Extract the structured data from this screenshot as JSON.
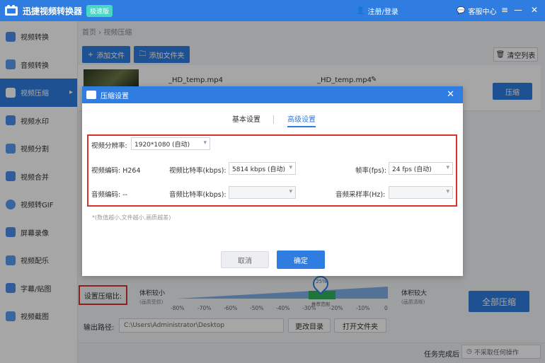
{
  "titlebar": {
    "app_title": "迅捷视频转换器",
    "badge": "极速版",
    "login": "注册/登录",
    "service": "客服中心",
    "minimize": "—",
    "close": "✕"
  },
  "sidebar": {
    "items": [
      {
        "label": "视频转换"
      },
      {
        "label": "音频转换"
      },
      {
        "label": "视频压缩"
      },
      {
        "label": "视频水印"
      },
      {
        "label": "视频分割"
      },
      {
        "label": "视频合并"
      },
      {
        "label": "视频转GIF"
      },
      {
        "label": "屏幕录像"
      },
      {
        "label": "视频配乐"
      },
      {
        "label": "字幕/贴图"
      },
      {
        "label": "视频截图"
      }
    ]
  },
  "breadcrumb": "首页 › 视频压缩",
  "toolbar": {
    "add_file": "添加文件",
    "add_folder": "添加文件夹",
    "clear_list": "清空列表"
  },
  "file": {
    "name_left": "_HD_temp.mp4",
    "name_right": "_HD_temp.mp4",
    "compress_btn": "压缩"
  },
  "dialog": {
    "title": "压缩设置",
    "tab_basic": "基本设置",
    "tab_advanced": "高级设置",
    "resolution_label": "视频分辨率:",
    "resolution_value": "1920*1080 (自动)",
    "video_codec": "视频编码: H264",
    "video_bitrate_label": "视频比特率(kbps):",
    "video_bitrate_value": "5814 kbps (自动)",
    "fps_label": "帧率(fps):",
    "fps_value": "24 fps (自动)",
    "audio_codec": "音频编码: --",
    "audio_bitrate_label": "音频比特率(kbps):",
    "audio_sample_label": "音频采样率(Hz):",
    "hint": "*(数值越小,文件越小,画质越差)",
    "cancel": "取消",
    "confirm": "确定"
  },
  "compression": {
    "ratio_label": "设置压缩比:",
    "left_label": "体积较小",
    "left_sub": "(画质受损)",
    "right_label": "体积较大",
    "right_sub": "(画质清晰)",
    "pin_value": "25%",
    "recommend": "推荐范围",
    "ticks": [
      "-80%",
      "-70%",
      "-60%",
      "-50%",
      "-40%",
      "-30%",
      "-20%",
      "-10%",
      "0"
    ]
  },
  "output": {
    "label": "输出路径:",
    "path": "C:\\Users\\Administrator\\Desktop",
    "change_dir": "更改目录",
    "open_folder": "打开文件夹",
    "compress_all": "全部压缩"
  },
  "status": {
    "after_done_label": "任务完成后",
    "after_done_value": "不采取任何操作"
  },
  "colors": {
    "primary": "#2f7de1",
    "highlight_red": "#d9342b",
    "recommend_green": "#2fb35a"
  }
}
